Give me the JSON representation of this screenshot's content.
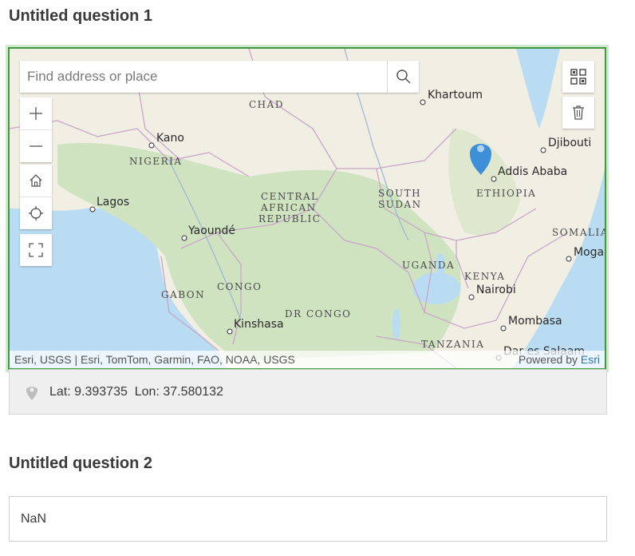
{
  "question1": {
    "title": "Untitled question 1"
  },
  "map": {
    "search_placeholder": "Find address or place",
    "tools": [
      "zoom-in",
      "zoom-out",
      "home",
      "locate",
      "fullscreen"
    ],
    "side_tools": [
      "basemap-gallery",
      "delete"
    ],
    "cities": [
      "Khartoum",
      "Kano",
      "Djibouti",
      "Addis Ababa",
      "Lagos",
      "Yaoundé",
      "Nairobi",
      "Mombasa",
      "Kinshasa",
      "Mogad",
      "Dar es Salaam"
    ],
    "countries": [
      "CHAD",
      "NIGERIA",
      "CENTRAL",
      "AFRICAN",
      "REPUBLIC",
      "SOUTH",
      "SUDAN",
      "ETHIOPIA",
      "SOMALIA",
      "UGANDA",
      "KENYA",
      "GABON",
      "CONGO",
      "DR CONGO",
      "TANZANIA"
    ],
    "attribution_left": "Esri, USGS | Esri, TomTom, Garmin, FAO, NOAA, USGS",
    "powered_by": "Powered by",
    "powered_by_link": "Esri",
    "colors": {
      "frame": "#3d9a3d",
      "pin": "#3d8fd8",
      "ocean": "#b9dcf2",
      "land": "#f1efe4",
      "forest": "#cfe3c0"
    }
  },
  "coordinates": {
    "text": "Lat: 9.393735  Lon: 37.580132"
  },
  "question2": {
    "title": "Untitled question 2",
    "value": "NaN"
  }
}
